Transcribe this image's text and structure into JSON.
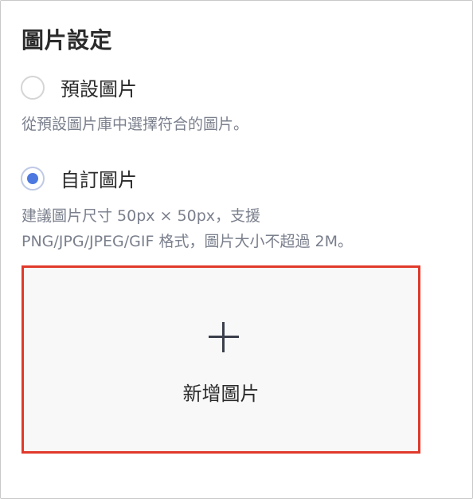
{
  "section": {
    "title": "圖片設定"
  },
  "options": {
    "preset": {
      "label": "預設圖片",
      "help": "從預設圖片庫中選擇符合的圖片。",
      "selected": false
    },
    "custom": {
      "label": "自訂圖片",
      "help_line1": "建議圖片尺寸 50px × 50px，支援",
      "help_line2": "PNG/JPG/JPEG/GIF 格式，圖片大小不超過 2M。",
      "selected": true
    }
  },
  "upload": {
    "label": "新增圖片",
    "icon": "plus-icon"
  },
  "colors": {
    "accent": "#4d78e0",
    "highlight_border": "#e0392b",
    "muted_text": "#7a7f8c"
  }
}
